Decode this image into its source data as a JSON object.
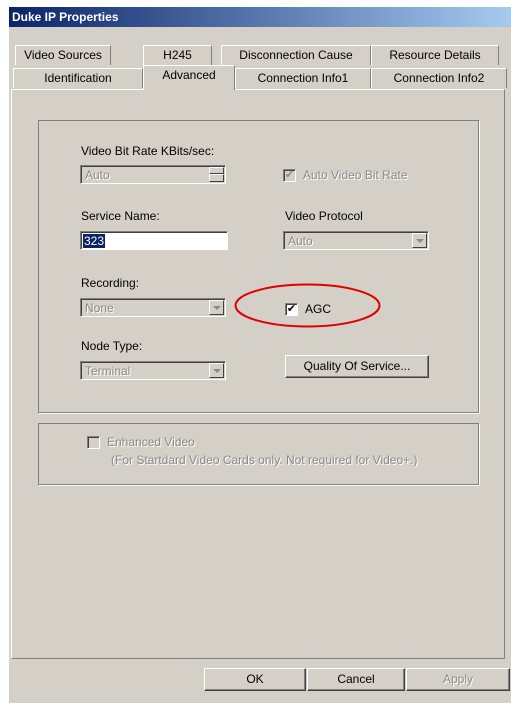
{
  "window": {
    "title": "Duke IP Properties"
  },
  "tabs_row1": [
    "Video Sources",
    "H245",
    "Disconnection Cause",
    "Resource Details"
  ],
  "tabs_row2": [
    "Identification",
    "Advanced",
    "Connection Info1",
    "Connection Info2"
  ],
  "selected_tab": "Advanced",
  "advanced": {
    "bitrate_label": "Video Bit Rate KBits/sec:",
    "bitrate_value": "Auto",
    "auto_bitrate_label": "Auto Video Bit Rate",
    "auto_bitrate_checked": true,
    "service_name_label": "Service Name:",
    "service_name_value": "323",
    "video_protocol_label": "Video Protocol",
    "video_protocol_value": "Auto",
    "recording_label": "Recording:",
    "recording_value": "None",
    "agc_label": "AGC",
    "agc_checked": true,
    "node_type_label": "Node Type:",
    "node_type_value": "Terminal",
    "qos_button": "Quality Of Service...",
    "enhanced_video_label": "Enhanced Video",
    "enhanced_video_checked": false,
    "enhanced_video_note": "(For Startdard Video Cards only. Not required for Video+.)"
  },
  "buttons": {
    "ok": "OK",
    "cancel": "Cancel",
    "apply": "Apply"
  },
  "annotation": {
    "circle_color": "#e00000",
    "check_glyph": "✔"
  }
}
